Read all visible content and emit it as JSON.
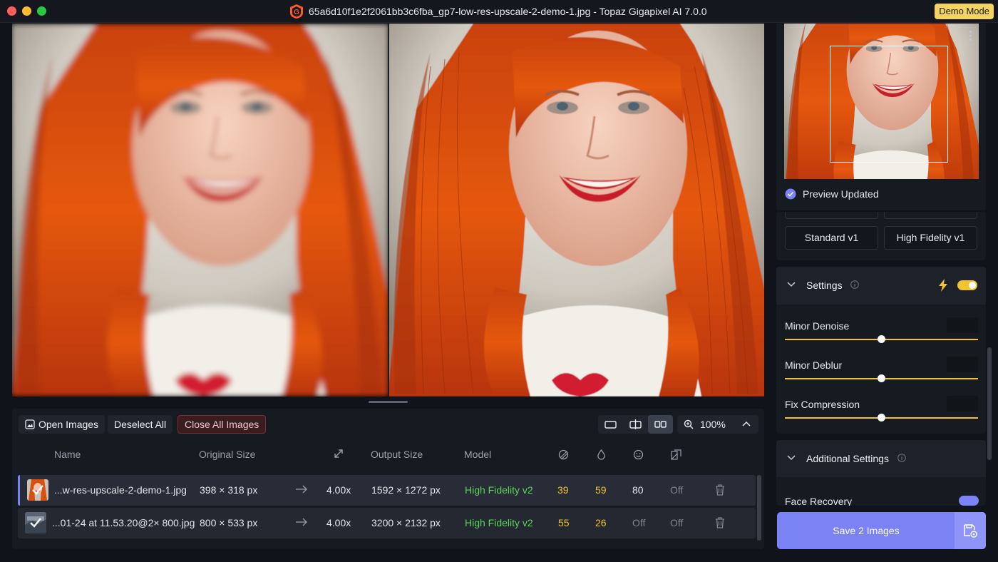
{
  "window": {
    "title": "65a6d10f1e2f2061bb3c6fba_gp7-low-res-upscale-2-demo-1.jpg - Topaz Gigapixel AI 7.0.0",
    "demo_badge": "Demo Mode"
  },
  "toolbar": {
    "open_images": "Open Images",
    "deselect_all": "Deselect All",
    "close_all_images": "Close All Images",
    "zoom": "100%",
    "active_view": "side-by-side"
  },
  "table": {
    "headers": {
      "name": "Name",
      "original_size": "Original Size",
      "output_size": "Output Size",
      "model": "Model"
    },
    "header_icons": [
      "expand-arrows-icon",
      "denoise-icon",
      "droplet-icon",
      "face-icon",
      "compression-icon"
    ],
    "rows": [
      {
        "name": "...w-res-upscale-2-demo-1.jpg",
        "original_size": "398 × 318 px",
        "scale": "4.00x",
        "output_size": "1592 × 1272 px",
        "model": "High Fidelity v2",
        "denoise": "39",
        "deblur": "59",
        "face": "80",
        "compression": "Off",
        "selected": true
      },
      {
        "name": "...01-24 at 11.53.20@2× 800.jpg",
        "original_size": "800 × 533 px",
        "scale": "4.00x",
        "output_size": "3200 × 2132 px",
        "model": "High Fidelity v2",
        "denoise": "55",
        "deblur": "26",
        "face": "Off",
        "compression": "Off",
        "selected": false
      }
    ]
  },
  "sidebar": {
    "preview_status": "Preview Updated",
    "models": [
      "Standard v1",
      "High Fidelity v1"
    ],
    "settings": {
      "title": "Settings",
      "enabled": true,
      "sliders": [
        {
          "label": "Minor Denoise",
          "value": 0.5
        },
        {
          "label": "Minor Deblur",
          "value": 0.5
        },
        {
          "label": "Fix Compression",
          "value": 0.5
        }
      ]
    },
    "additional": {
      "title": "Additional Settings",
      "face_recovery": "Face Recovery"
    }
  },
  "save": {
    "label": "Save 2 Images"
  },
  "colors": {
    "accent": "#7b82f4",
    "highlight": "#f2c230",
    "model_green": "#5fd35c",
    "demo_badge": "#f4d35e"
  }
}
